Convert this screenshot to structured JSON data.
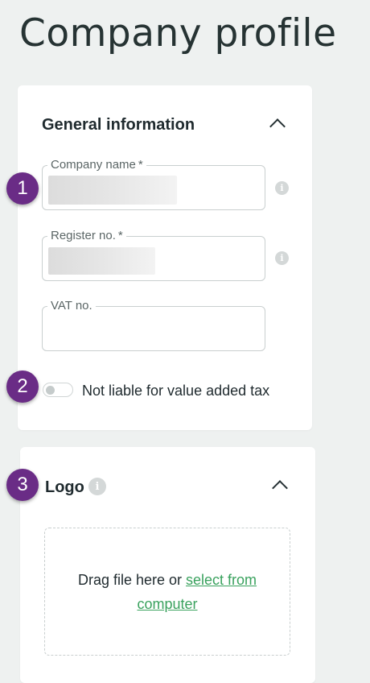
{
  "page": {
    "title": "Company profile"
  },
  "general": {
    "title": "General information",
    "fields": {
      "company_name": {
        "label": "Company name",
        "required_mark": "*"
      },
      "register_no": {
        "label": "Register no.",
        "required_mark": "*"
      },
      "vat_no": {
        "label": "VAT no."
      }
    },
    "toggle": {
      "label": "Not liable for value added tax",
      "on": false
    }
  },
  "logo": {
    "title": "Logo",
    "drop_text": "Drag file here or ",
    "select_link": "select from computer"
  },
  "badges": [
    "1",
    "2",
    "3"
  ],
  "colors": {
    "accent_purple": "#6a2c86",
    "link_green": "#3aa25e"
  },
  "icons": {
    "info": "info-icon",
    "collapse": "chevron-up-icon"
  }
}
